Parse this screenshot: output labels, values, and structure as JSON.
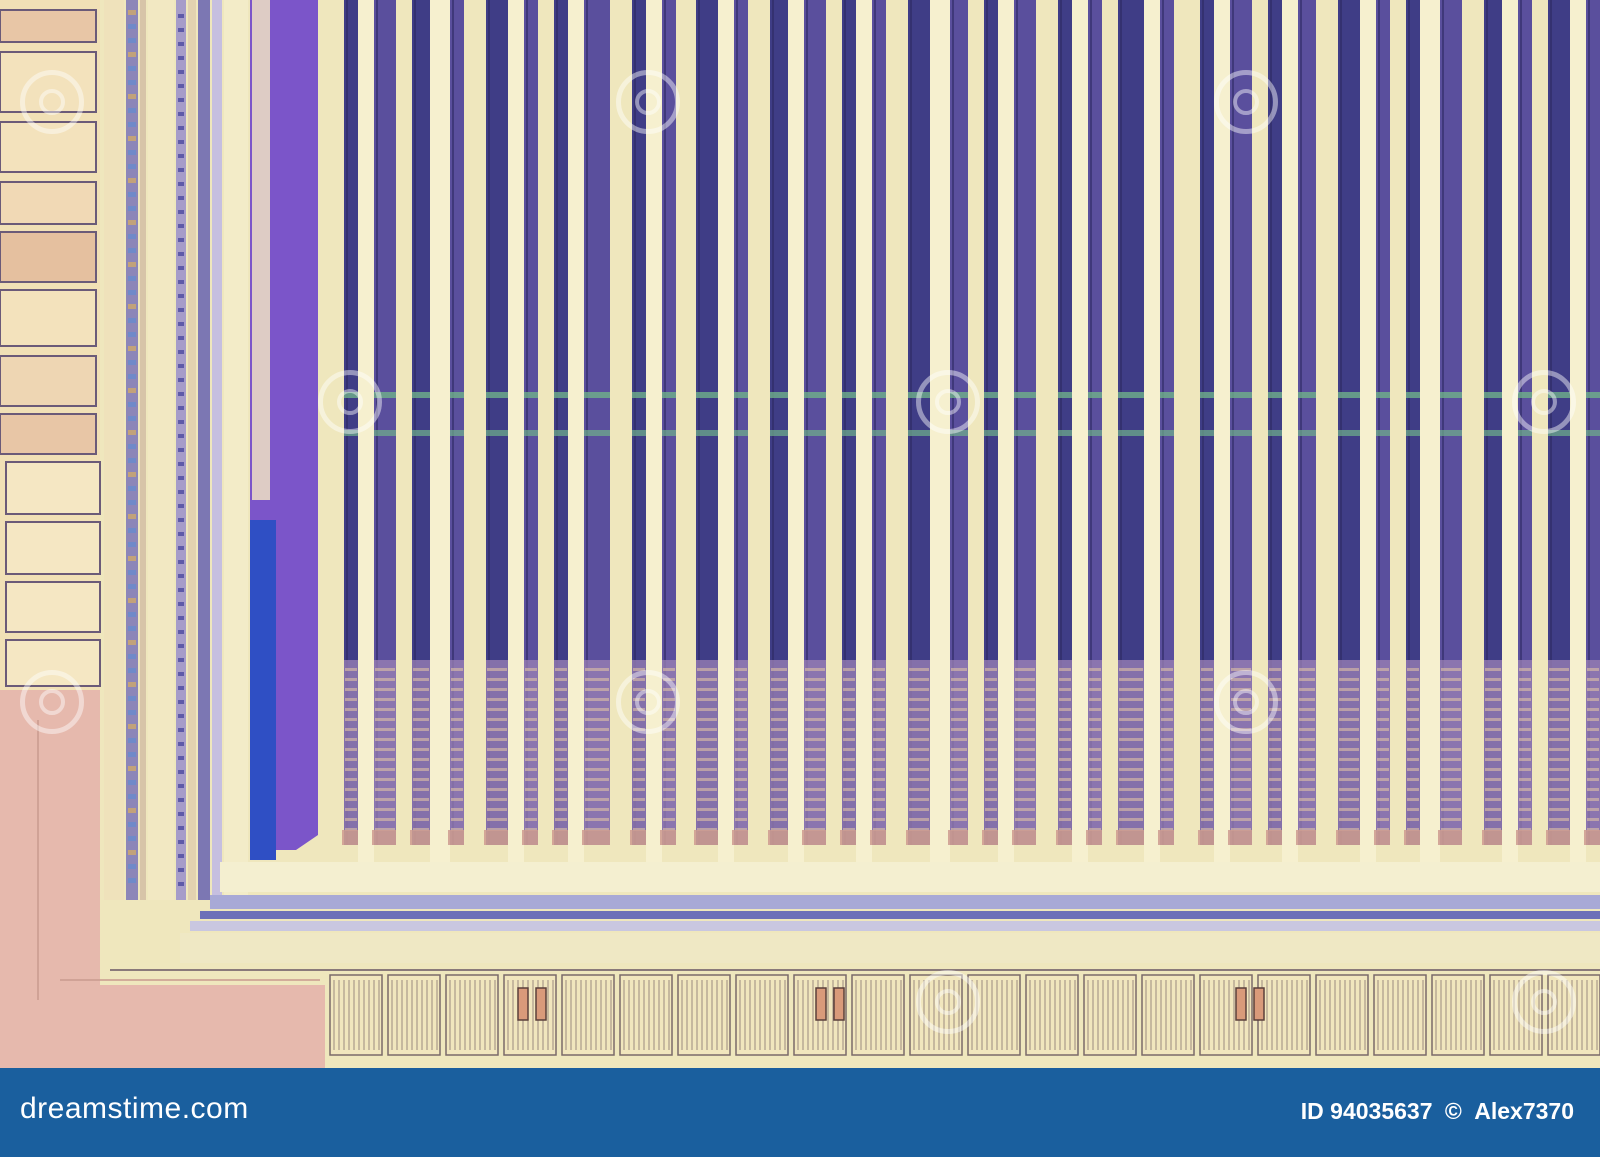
{
  "image": {
    "subject": "chip",
    "palette": {
      "metal": "#efe7bd",
      "metal_light": "#f6f0cf",
      "trench": "#3f3d86",
      "trench_alt": "#5a4f9d",
      "violet": "#7b55c9",
      "blue_deep": "#2f4fc4",
      "pink": "#e6b9ad",
      "stripe_dark": "#2d2a63"
    }
  },
  "watermark": {
    "logo_text": "dreamstime.com",
    "id_text": "ID 94035637",
    "copyright_symbol": "©",
    "author": "Alex7370",
    "bar_color": "#1a5f9e"
  }
}
